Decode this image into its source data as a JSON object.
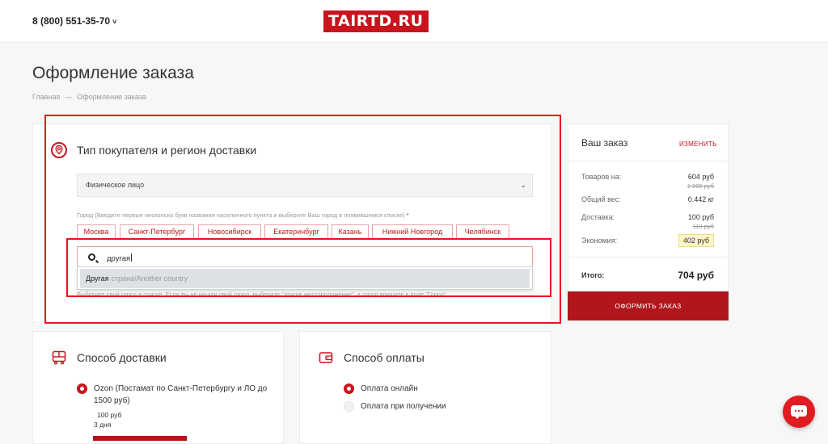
{
  "header": {
    "phone": "8 (800) 551-35-70",
    "phone_caret": "˅",
    "logo": "TAIRTD.RU"
  },
  "page": {
    "title": "Оформление заказа",
    "breadcrumb": [
      "Главная",
      "Оформление заказа"
    ],
    "breadcrumb_sep": "—"
  },
  "buyer": {
    "title": "Тип покупателя и регион доставки",
    "type_selected": "Физическое лицо",
    "city_hint": "Город (Введите первые несколько букв названия населенного пункта и выберите Ваш город в появившемся списке)",
    "required_mark": "*",
    "cities": [
      "Москва",
      "Санкт-Петербург",
      "Новосибирск",
      "Екатеринбург",
      "Казань",
      "Нижний Новгород",
      "Челябинск"
    ],
    "search_value": "другая",
    "suggestion_main": "Другая",
    "suggestion_sub": "страна/Another country",
    "bottom_hint": "Выберите свой город в списке. Если вы не нашли свой город, выберите \"другое местоположение\", а город впишите в поле \"Город\""
  },
  "delivery": {
    "title": "Способ доставки",
    "option_label": "Ozon (Постамат по Санкт-Петербургу и ЛО до 1500 руб)",
    "price": "100 руб",
    "days": "3 дня"
  },
  "payment": {
    "title": "Способ оплаты",
    "options": [
      "Оплата онлайн",
      "Оплата при получении"
    ]
  },
  "order": {
    "title": "Ваш заказ",
    "change": "ИЗМЕНИТЬ",
    "rows": [
      {
        "label": "Товаров на:",
        "value": "604 руб",
        "old": "1 006 руб"
      },
      {
        "label": "Общий вес:",
        "value": "0.442 кг"
      },
      {
        "label": "Доставка:",
        "value": "100 руб",
        "old": "119 руб"
      },
      {
        "label": "Экономия:",
        "value": "402 руб"
      }
    ],
    "total_label": "Итого:",
    "total_value": "704 руб",
    "checkout": "ОФОРМИТЬ ЗАКАЗ"
  },
  "colors": {
    "accent": "#c8141e",
    "button": "#b0161c",
    "highlight": "#e8151b"
  }
}
